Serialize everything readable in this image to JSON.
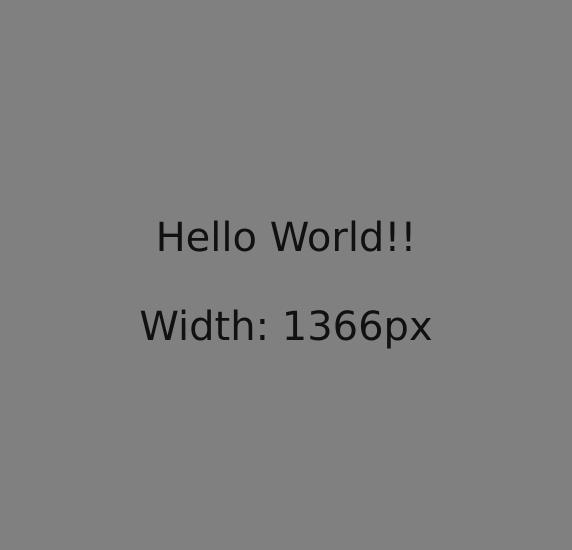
{
  "page": {
    "background_color": "#808080",
    "text_color": "#111111"
  },
  "content": {
    "greeting": "Hello World!!",
    "width_readout": "Width: 1366px"
  }
}
